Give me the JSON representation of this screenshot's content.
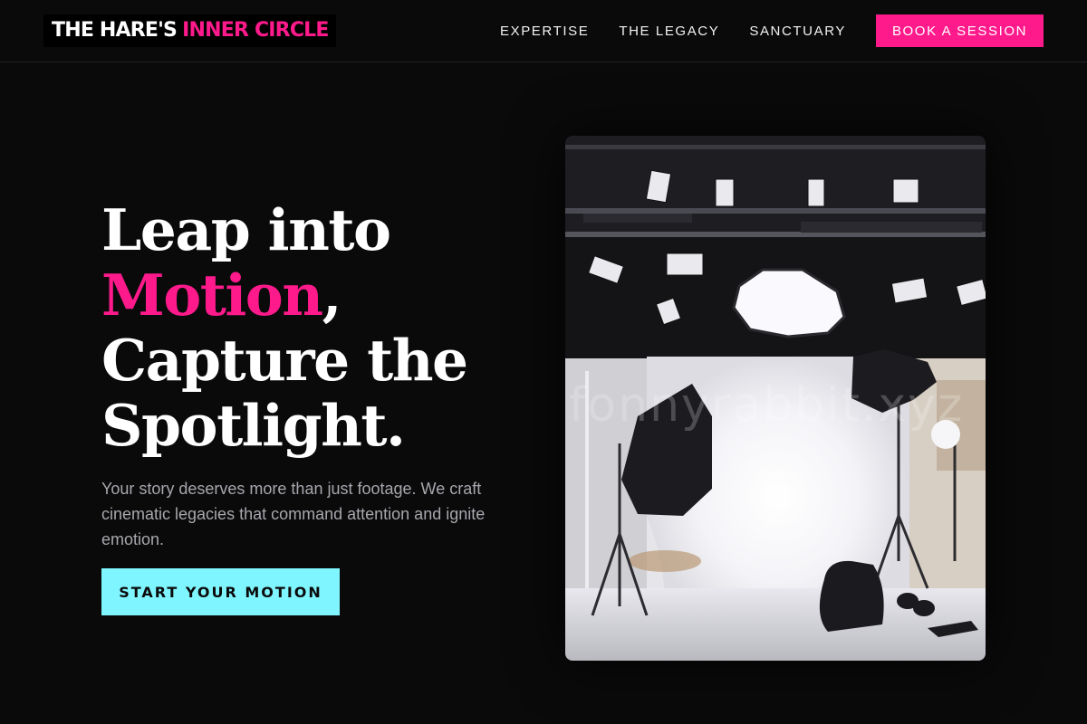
{
  "header": {
    "logo_main": "THE HARE'S",
    "logo_accent": "INNER CIRCLE",
    "nav": [
      {
        "label": "EXPERTISE"
      },
      {
        "label": "THE LEGACY"
      },
      {
        "label": "SANCTUARY"
      }
    ],
    "book_label": "BOOK A SESSION"
  },
  "hero": {
    "title_line1": "Leap into",
    "title_accent": "Motion",
    "title_comma": ",",
    "title_line3": "Capture the",
    "title_line4": "Spotlight.",
    "subtitle": "Your story deserves more than just footage. We craft cinematic legacies that command attention and ignite emotion.",
    "cta_label": "START YOUR MOTION"
  },
  "image": {
    "watermark": "fonnyrabbit.xyz"
  },
  "colors": {
    "background": "#0a0a0b",
    "accent_pink": "#ff1a8c",
    "accent_cyan": "#7ff6ff",
    "subtitle_gray": "#a7a7ad"
  }
}
